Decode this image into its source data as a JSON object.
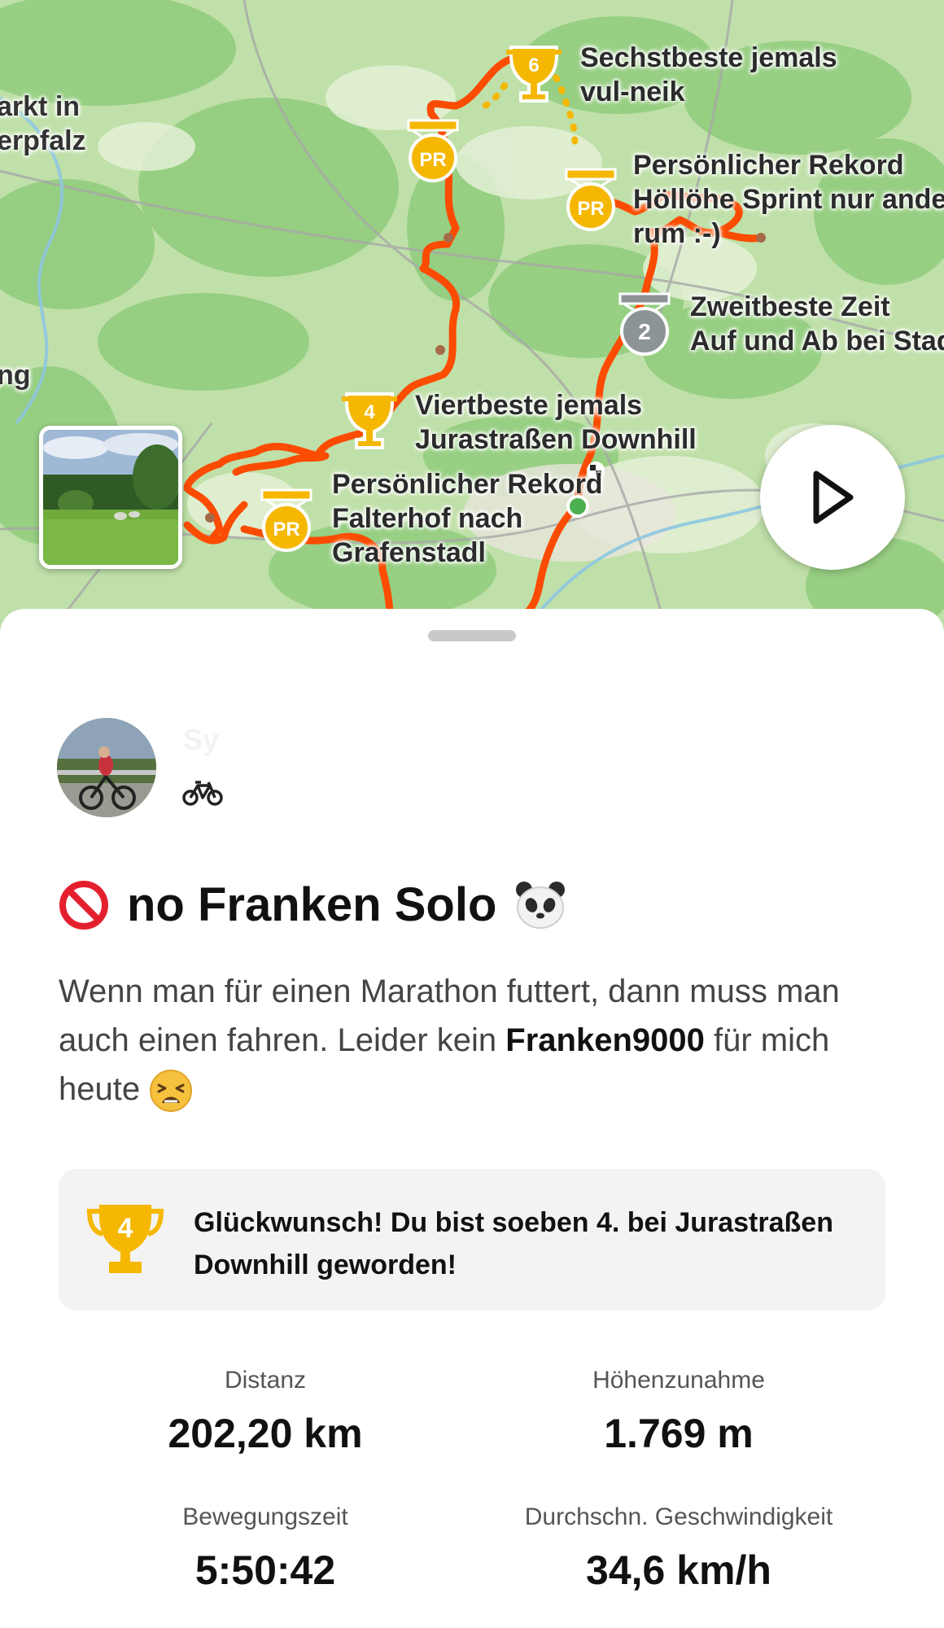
{
  "map": {
    "places": [
      "arkt in",
      "erpfalz",
      "ng"
    ],
    "segments": [
      {
        "icon": "trophy-6-icon",
        "rank": "6",
        "line1": "Sechstbeste jemals",
        "line2": "vul-neik",
        "line3": ""
      },
      {
        "icon": "pr-medal-icon",
        "rank": "PR",
        "line1": "Persönlicher Rekord",
        "line2": "Höllöhe Sprint nur ande",
        "line3": "rum :-)"
      },
      {
        "icon": "silver-medal-2-icon",
        "rank": "2",
        "line1": "Zweitbeste Zeit",
        "line2": "Auf und Ab bei Stad",
        "line3": ""
      },
      {
        "icon": "trophy-4-icon",
        "rank": "4",
        "line1": "Viertbeste jemals",
        "line2": "Jurastraßen Downhill",
        "line3": ""
      },
      {
        "icon": "pr-medal-icon",
        "rank": "PR",
        "line1": "Persönlicher Rekord",
        "line2": "Falterhof nach",
        "line3": "Grafenstadl"
      },
      {
        "icon": "pr-medal-icon",
        "rank": "PR",
        "line1": "",
        "line2": "",
        "line3": ""
      }
    ],
    "colors": {
      "route": "#fc4c02",
      "trophy_gold": "#f5b700",
      "silver": "#8d9498",
      "start": "#4caf50"
    }
  },
  "activity": {
    "athlete_name": "Sy",
    "type_icon": "bike-icon",
    "title_prefix_emoji": "🚫",
    "title": "no Franken Solo",
    "title_suffix_emoji": "🐼",
    "description_part1": "Wenn man für einen Marathon futtert, dann muss man auch einen fahren. Leider kein ",
    "description_bold": "Franken9000",
    "description_part2": " für mich heute",
    "description_emoji": "😫"
  },
  "achievement": {
    "icon": "trophy-4-icon",
    "rank": "4",
    "text": "Glückwunsch! Du bist soeben 4. bei Jurastraßen Downhill geworden!"
  },
  "stats": [
    {
      "label": "Distanz",
      "value": "202,20 km"
    },
    {
      "label": "Höhenzunahme",
      "value": "1.769 m"
    },
    {
      "label": "Bewegungszeit",
      "value": "5:50:42"
    },
    {
      "label": "Durchschn. Geschwindigkeit",
      "value": "34,6 km/h"
    }
  ]
}
